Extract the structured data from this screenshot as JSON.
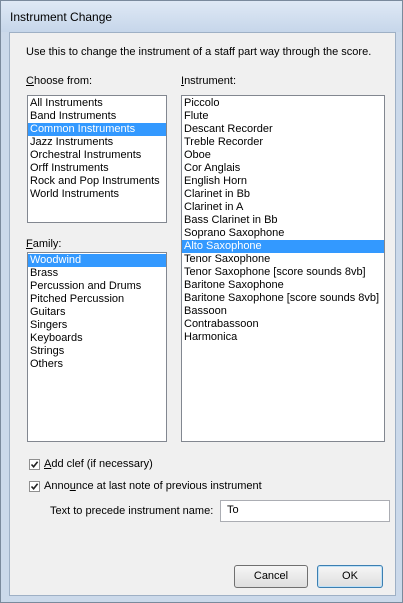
{
  "window": {
    "title": "Instrument Change"
  },
  "intro": "Use this to change the instrument of a staff part way through the score.",
  "choose_from": {
    "label_ul": "C",
    "label_rest": "hoose from:",
    "items": [
      {
        "label": "All Instruments",
        "selected": false
      },
      {
        "label": "Band Instruments",
        "selected": false
      },
      {
        "label": "Common Instruments",
        "selected": true
      },
      {
        "label": "Jazz Instruments",
        "selected": false
      },
      {
        "label": "Orchestral Instruments",
        "selected": false
      },
      {
        "label": "Orff Instruments",
        "selected": false
      },
      {
        "label": "Rock and Pop Instruments",
        "selected": false
      },
      {
        "label": "World Instruments",
        "selected": false
      }
    ]
  },
  "family": {
    "label_ul": "F",
    "label_rest": "amily:",
    "items": [
      {
        "label": "Woodwind",
        "selected": true
      },
      {
        "label": "Brass",
        "selected": false
      },
      {
        "label": "Percussion and Drums",
        "selected": false
      },
      {
        "label": "Pitched Percussion",
        "selected": false
      },
      {
        "label": "Guitars",
        "selected": false
      },
      {
        "label": "Singers",
        "selected": false
      },
      {
        "label": "Keyboards",
        "selected": false
      },
      {
        "label": "Strings",
        "selected": false
      },
      {
        "label": "Others",
        "selected": false
      }
    ]
  },
  "instrument": {
    "label_ul": "I",
    "label_rest": "nstrument:",
    "items": [
      {
        "label": "Piccolo",
        "selected": false
      },
      {
        "label": "Flute",
        "selected": false
      },
      {
        "label": "Descant Recorder",
        "selected": false
      },
      {
        "label": "Treble Recorder",
        "selected": false
      },
      {
        "label": "Oboe",
        "selected": false
      },
      {
        "label": "Cor Anglais",
        "selected": false
      },
      {
        "label": "English Horn",
        "selected": false
      },
      {
        "label": "Clarinet in Bb",
        "selected": false
      },
      {
        "label": "Clarinet in A",
        "selected": false
      },
      {
        "label": "Bass Clarinet in Bb",
        "selected": false
      },
      {
        "label": "Soprano Saxophone",
        "selected": false
      },
      {
        "label": "Alto Saxophone",
        "selected": true
      },
      {
        "label": "Tenor Saxophone",
        "selected": false
      },
      {
        "label": "Tenor Saxophone [score sounds 8vb]",
        "selected": false
      },
      {
        "label": "Baritone Saxophone",
        "selected": false
      },
      {
        "label": "Baritone Saxophone [score sounds 8vb]",
        "selected": false
      },
      {
        "label": "Bassoon",
        "selected": false
      },
      {
        "label": "Contrabassoon",
        "selected": false
      },
      {
        "label": "Harmonica",
        "selected": false
      }
    ]
  },
  "add_clef": {
    "label_ul": "A",
    "label_rest": "dd clef (if necessary)",
    "checked": true
  },
  "announce": {
    "label_pre": "Anno",
    "label_ul": "u",
    "label_rest": "nce at last note of previous instrument",
    "checked": true
  },
  "precede": {
    "label": "Text to precede instrument name:",
    "value": "To"
  },
  "buttons": {
    "cancel": "Cancel",
    "ok": "OK"
  }
}
